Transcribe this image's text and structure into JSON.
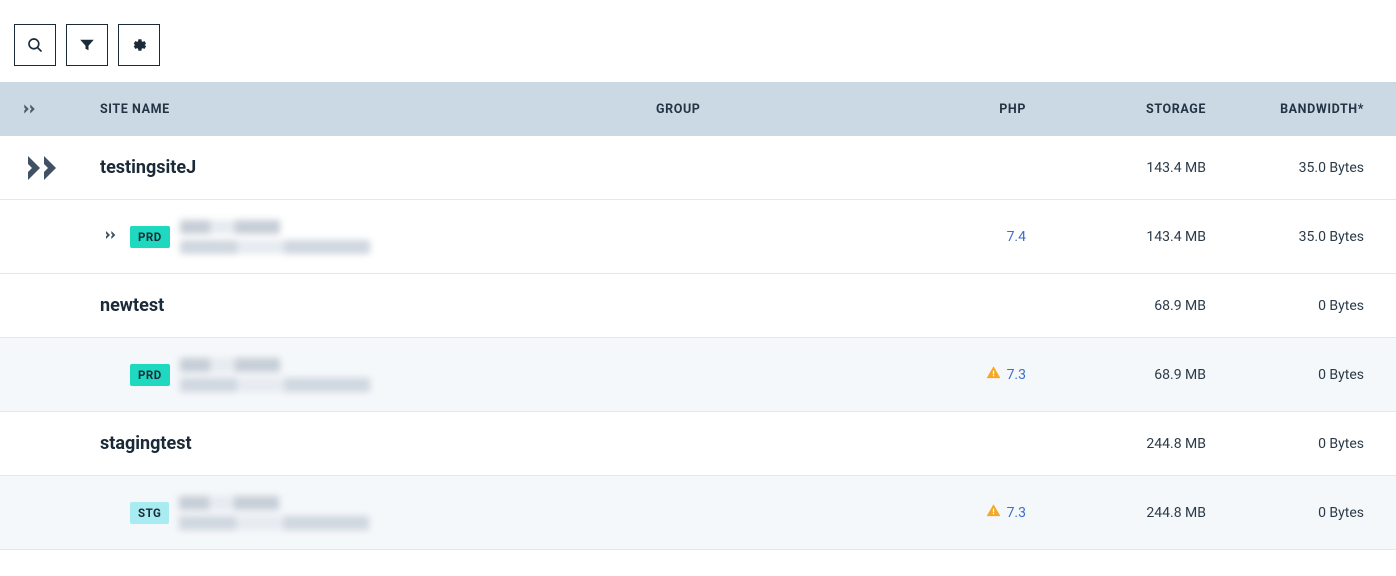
{
  "headers": {
    "site_name": "SITE NAME",
    "group": "GROUP",
    "php": "PHP",
    "storage": "STORAGE",
    "bandwidth": "BANDWIDTH*"
  },
  "sites": [
    {
      "name": "testingsiteJ",
      "storage": "143.4 MB",
      "bandwidth": "35.0 Bytes",
      "env": {
        "badge": "PRD",
        "badge_class": "badge-prd",
        "show_expand": true,
        "php": "7.4",
        "php_warning": false,
        "storage": "143.4 MB",
        "bandwidth": "35.0 Bytes",
        "row_class": "first"
      }
    },
    {
      "name": "newtest",
      "storage": "68.9 MB",
      "bandwidth": "0 Bytes",
      "env": {
        "badge": "PRD",
        "badge_class": "badge-prd",
        "show_expand": false,
        "php": "7.3",
        "php_warning": true,
        "storage": "68.9 MB",
        "bandwidth": "0 Bytes",
        "row_class": ""
      }
    },
    {
      "name": "stagingtest",
      "storage": "244.8 MB",
      "bandwidth": "0 Bytes",
      "env": {
        "badge": "STG",
        "badge_class": "badge-stg",
        "show_expand": false,
        "php": "7.3",
        "php_warning": true,
        "storage": "244.8 MB",
        "bandwidth": "0 Bytes",
        "row_class": ""
      }
    }
  ]
}
